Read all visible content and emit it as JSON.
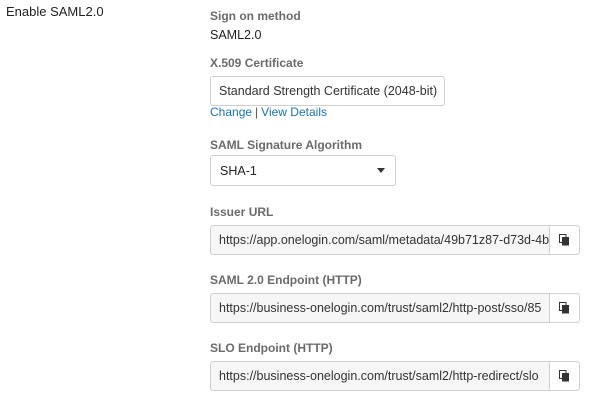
{
  "section": {
    "title": "Enable SAML2.0"
  },
  "sign_on": {
    "label": "Sign on method",
    "value": "SAML2.0"
  },
  "certificate": {
    "label": "X.509 Certificate",
    "value": "Standard Strength Certificate (2048-bit)",
    "change_link": "Change",
    "separator": "|",
    "details_link": "View Details"
  },
  "signature": {
    "label": "SAML Signature Algorithm",
    "selected": "SHA-1"
  },
  "issuer": {
    "label": "Issuer URL",
    "value": "https://app.onelogin.com/saml/metadata/49b71z87-d73d-4b",
    "copy_icon": "copy-icon"
  },
  "endpoint": {
    "label": "SAML 2.0 Endpoint (HTTP)",
    "value": "https://business-onelogin.com/trust/saml2/http-post/sso/85",
    "copy_icon": "copy-icon"
  },
  "slo": {
    "label": "SLO Endpoint (HTTP)",
    "value": "https://business-onelogin.com/trust/saml2/http-redirect/slo",
    "copy_icon": "copy-icon"
  }
}
